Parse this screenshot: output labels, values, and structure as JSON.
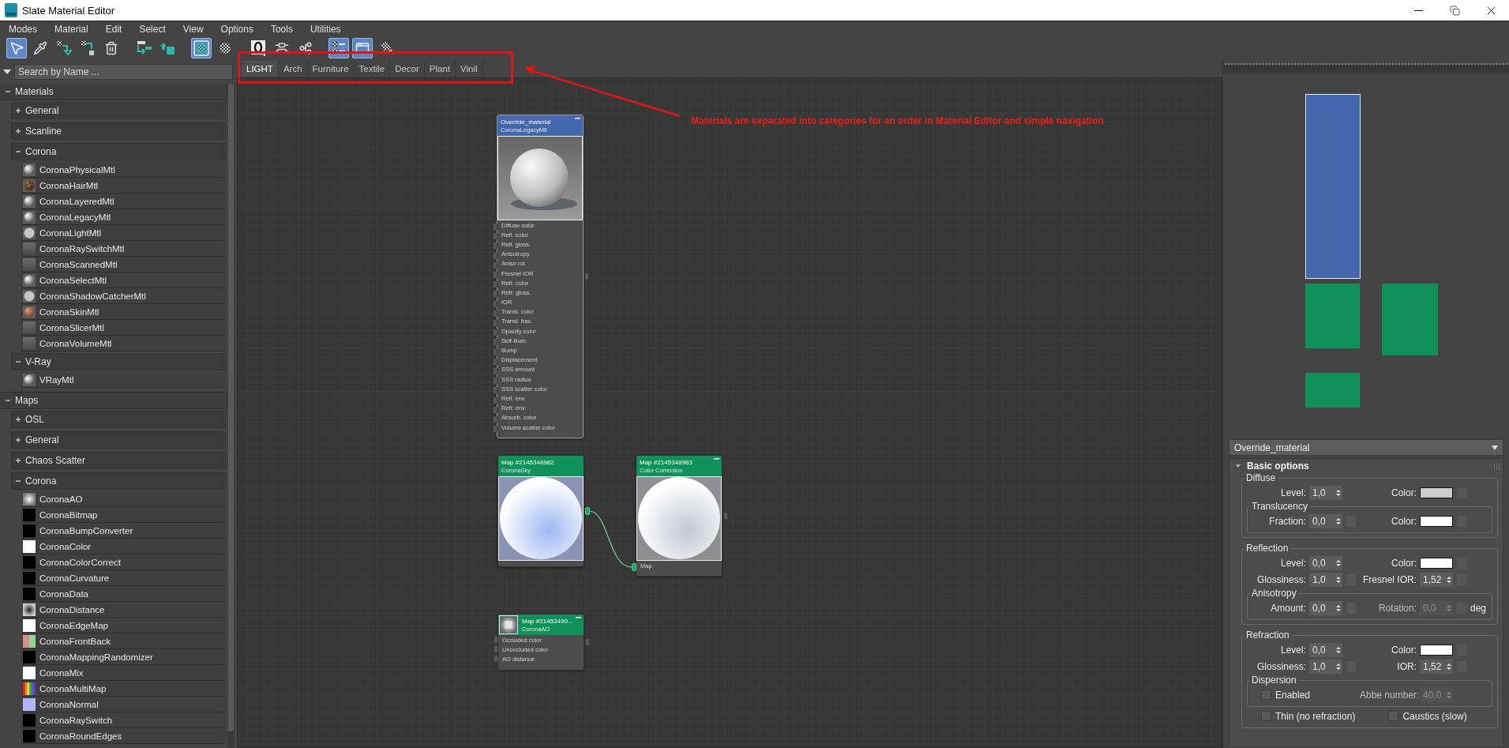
{
  "window": {
    "title": "Slate Material Editor"
  },
  "menu": [
    "Modes",
    "Material",
    "Edit",
    "Select",
    "View",
    "Options",
    "Tools",
    "Utilities"
  ],
  "toolbar": [
    {
      "pressed": true
    },
    {
      "pressed": false
    },
    {
      "pressed": false
    },
    {
      "pressed": false
    },
    {
      "pressed": false
    },
    {
      "pressed": false
    },
    {
      "pressed": false
    },
    {
      "pressed": true
    },
    {
      "pressed": false
    },
    {
      "pressed": false
    },
    {
      "pressed": false
    },
    {
      "pressed": false
    },
    {
      "pressed": true
    },
    {
      "pressed": true
    },
    {
      "pressed": false
    }
  ],
  "browser": {
    "search": {
      "placeholder": "Search by Name ..."
    },
    "sections": [
      {
        "label": "Materials",
        "expanded": true,
        "groups": [
          {
            "label": "General",
            "expanded": false
          },
          {
            "label": "Scanline",
            "expanded": false
          },
          {
            "label": "Corona",
            "expanded": true,
            "items": [
              {
                "label": "CoronaPhysicalMtl",
                "kind": "sphere"
              },
              {
                "label": "CoronaHairMtl",
                "kind": "hair"
              },
              {
                "label": "CoronaLayeredMtl",
                "kind": "sphere"
              },
              {
                "label": "CoronaLegacyMtl",
                "kind": "sphere"
              },
              {
                "label": "CoronaLightMtl",
                "kind": "disc"
              },
              {
                "label": "CoronaRaySwitchMtl",
                "kind": "flat"
              },
              {
                "label": "CoronaScannedMtl",
                "kind": "flat"
              },
              {
                "label": "CoronaSelectMtl",
                "kind": "sphere"
              },
              {
                "label": "CoronaShadowCatcherMtl",
                "kind": "disc"
              },
              {
                "label": "CoronaSkinMtl",
                "kind": "skin"
              },
              {
                "label": "CoronaSlicerMtl",
                "kind": "flat"
              },
              {
                "label": "CoronaVolumeMtl",
                "kind": "flat"
              }
            ]
          },
          {
            "label": "V-Ray",
            "expanded": true,
            "items": [
              {
                "label": "VRayMtl",
                "kind": "sphere"
              }
            ]
          }
        ]
      },
      {
        "label": "Maps",
        "expanded": true,
        "groups": [
          {
            "label": "OSL",
            "expanded": false
          },
          {
            "label": "General",
            "expanded": false
          },
          {
            "label": "Chaos Scatter",
            "expanded": false
          },
          {
            "label": "Corona",
            "expanded": true,
            "items": [
              {
                "label": "CoronaAO",
                "kind": "ao"
              },
              {
                "label": "CoronaBitmap",
                "kind": "solid",
                "color": "#000000"
              },
              {
                "label": "CoronaBumpConverter",
                "kind": "solid",
                "color": "#000000"
              },
              {
                "label": "CoronaColor",
                "kind": "solid",
                "color": "#ffffff"
              },
              {
                "label": "CoronaColorCorrect",
                "kind": "solid",
                "color": "#000000"
              },
              {
                "label": "CoronaCurvature",
                "kind": "solid",
                "color": "#000000"
              },
              {
                "label": "CoronaData",
                "kind": "solid",
                "color": "#000000"
              },
              {
                "label": "CoronaDistance",
                "kind": "distance"
              },
              {
                "label": "CoronaEdgeMap",
                "kind": "solid",
                "color": "#ffffff"
              },
              {
                "label": "CoronaFrontBack",
                "kind": "frontback"
              },
              {
                "label": "CoronaMappingRandomizer",
                "kind": "solid",
                "color": "#000000"
              },
              {
                "label": "CoronaMix",
                "kind": "solid",
                "color": "#ffffff"
              },
              {
                "label": "CoronaMultiMap",
                "kind": "multimap"
              },
              {
                "label": "CoronaNormal",
                "kind": "solid",
                "color": "#b4b4ff"
              },
              {
                "label": "CoronaRaySwitch",
                "kind": "solid",
                "color": "#000000"
              },
              {
                "label": "CoronaRoundEdges",
                "kind": "solid",
                "color": "#000000"
              }
            ]
          }
        ]
      }
    ]
  },
  "tabs": [
    {
      "label": "LIGHT",
      "selected": true
    },
    {
      "label": "Arch",
      "selected": false
    },
    {
      "label": "Furniture",
      "selected": false
    },
    {
      "label": "Textile",
      "selected": false
    },
    {
      "label": "Decor",
      "selected": false
    },
    {
      "label": "Plant",
      "selected": false
    },
    {
      "label": "Vinil",
      "selected": false
    }
  ],
  "nodes": [
    {
      "kind": "material",
      "title": "Override_material",
      "subtitle": "CoronaLegacyMtl",
      "selected": true,
      "minimizable": true,
      "output_connected": false,
      "slots": [
        {
          "label": "Diffuse color",
          "connected": false
        },
        {
          "label": "Refl. color",
          "connected": false
        },
        {
          "label": "Refl. gloss.",
          "connected": false
        },
        {
          "label": "Anisotropy",
          "connected": false
        },
        {
          "label": "Aniso rot.",
          "connected": false
        },
        {
          "label": "Fresnel IOR",
          "connected": false
        },
        {
          "label": "Refr. color",
          "connected": false
        },
        {
          "label": "Refr. gloss.",
          "connected": false
        },
        {
          "label": "IOR",
          "connected": false
        },
        {
          "label": "Transl. color",
          "connected": false
        },
        {
          "label": "Transl. frac.",
          "connected": false
        },
        {
          "label": "Opacity color",
          "connected": false
        },
        {
          "label": "Self-illum.",
          "connected": false
        },
        {
          "label": "Bump",
          "connected": false
        },
        {
          "label": "Displacement",
          "connected": false
        },
        {
          "label": "SSS amount",
          "connected": false
        },
        {
          "label": "SSS radius",
          "connected": false
        },
        {
          "label": "SSS scatter color",
          "connected": false
        },
        {
          "label": "Refl. env.",
          "connected": false
        },
        {
          "label": "Refr. env.",
          "connected": false
        },
        {
          "label": "Absorb. color",
          "connected": false
        },
        {
          "label": "Volume scatter color",
          "connected": false
        }
      ]
    },
    {
      "kind": "map",
      "title": "Map #2145348982",
      "subtitle": "CoronaSky",
      "selected": false,
      "minimizable": false,
      "output_connected": true
    },
    {
      "kind": "map",
      "title": "Map #2145348983",
      "subtitle": "Color Correction",
      "selected": false,
      "minimizable": true,
      "output_connected": false,
      "slots": [
        {
          "label": "Map",
          "connected": true
        }
      ]
    },
    {
      "kind": "map",
      "title": "Map #21453490...",
      "subtitle": "CoronaAO",
      "selected": false,
      "minimizable": true,
      "output_connected": false,
      "slots": [
        {
          "label": "Occluded color",
          "connected": false
        },
        {
          "label": "Unoccluded color",
          "connected": false
        },
        {
          "label": "AO distance",
          "connected": false
        }
      ]
    }
  ],
  "annotation": {
    "text": "Materials are separated into categories for an order in Material Editor and simple navigation"
  },
  "parameters": {
    "material": "Override_material",
    "rollout": {
      "title": "Basic options",
      "expanded": true
    },
    "groups": [
      {
        "title": "Diffuse",
        "items": [
          {
            "kind": "row",
            "left": {
              "kind": "spinner",
              "label": "Level:",
              "value": "1,0",
              "disabled": false,
              "map": false
            },
            "right": {
              "kind": "color",
              "label": "Color:",
              "color": "#cccccc",
              "map": true
            }
          },
          {
            "kind": "subgroup",
            "title": "Translucency",
            "items": [
              {
                "kind": "row",
                "left": {
                  "kind": "spinner",
                  "label": "Fraction:",
                  "value": "0,0",
                  "disabled": false,
                  "map": true
                },
                "right": {
                  "kind": "color",
                  "label": "Color:",
                  "color": "#ffffff",
                  "map": true
                }
              }
            ]
          }
        ]
      },
      {
        "title": "Reflection",
        "items": [
          {
            "kind": "row",
            "left": {
              "kind": "spinner",
              "label": "Level:",
              "value": "0,0",
              "disabled": false,
              "map": false
            },
            "right": {
              "kind": "color",
              "label": "Color:",
              "color": "#ffffff",
              "map": true
            }
          },
          {
            "kind": "row",
            "left": {
              "kind": "spinner",
              "label": "Glossiness:",
              "value": "1,0",
              "disabled": false,
              "map": true
            },
            "right": {
              "kind": "spinner",
              "label": "Fresnel IOR:",
              "value": "1,52",
              "disabled": false,
              "map": true
            }
          },
          {
            "kind": "subgroup",
            "title": "Anisotropy",
            "items": [
              {
                "kind": "row",
                "left": {
                  "kind": "spinner",
                  "label": "Amount:",
                  "value": "0,0",
                  "disabled": false,
                  "map": true
                },
                "right": {
                  "kind": "spinner",
                  "label": "Rotation:",
                  "value": "0,0",
                  "disabled": true,
                  "map": true,
                  "unit": "deg"
                }
              }
            ]
          }
        ]
      },
      {
        "title": "Refraction",
        "items": [
          {
            "kind": "row",
            "left": {
              "kind": "spinner",
              "label": "Level:",
              "value": "0,0",
              "disabled": false,
              "map": false
            },
            "right": {
              "kind": "color",
              "label": "Color:",
              "color": "#ffffff",
              "map": true
            }
          },
          {
            "kind": "row",
            "left": {
              "kind": "spinner",
              "label": "Glossiness:",
              "value": "1,0",
              "disabled": false,
              "map": true
            },
            "right": {
              "kind": "spinner",
              "label": "IOR:",
              "value": "1,52",
              "disabled": false,
              "map": true
            }
          },
          {
            "kind": "subgroup",
            "title": "Dispersion",
            "items": [
              {
                "kind": "row",
                "left": {
                  "kind": "check",
                  "label": "Enabled",
                  "checked": false
                },
                "right": {
                  "kind": "spinner",
                  "label": "Abbe number:",
                  "value": "40,0",
                  "disabled": true,
                  "map": false
                }
              }
            ]
          },
          {
            "kind": "row",
            "left": {
              "kind": "check",
              "label": "Thin (no refraction)",
              "checked": false
            },
            "right": {
              "kind": "check",
              "label": "Caustics (slow)",
              "checked": false
            }
          }
        ]
      }
    ]
  }
}
